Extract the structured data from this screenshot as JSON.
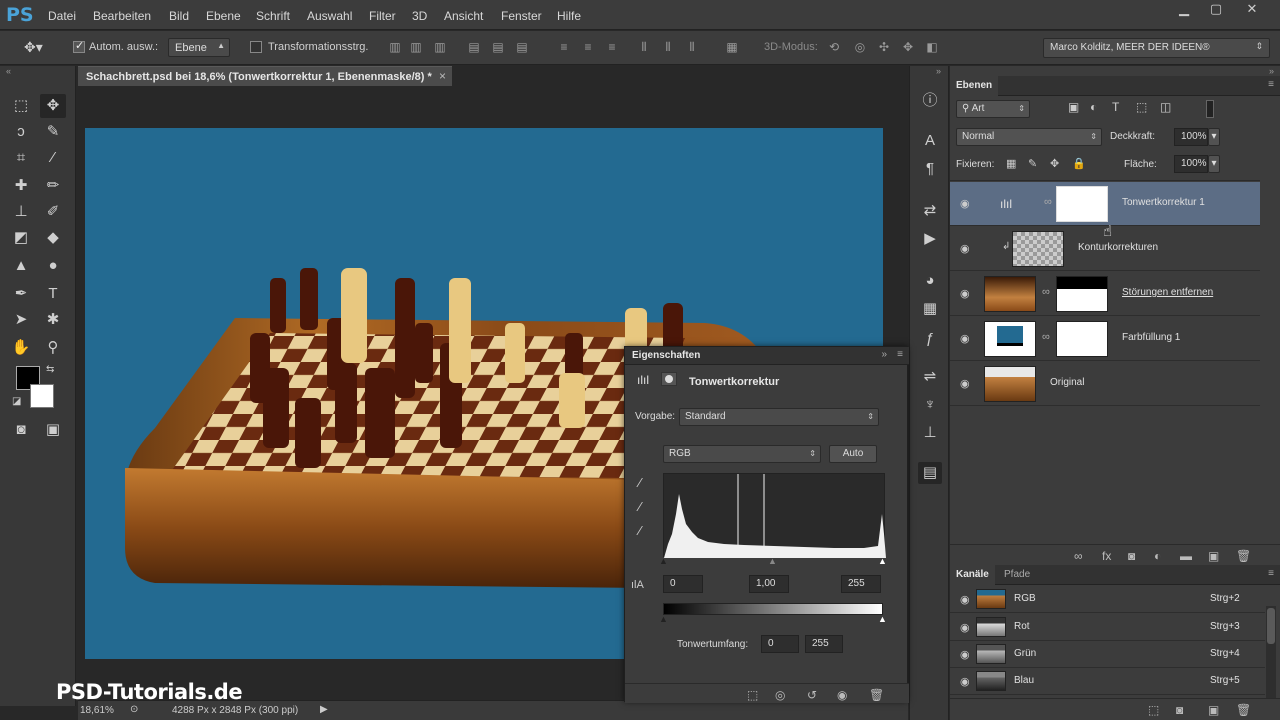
{
  "app": {
    "logo": "PS",
    "accent": "#4aa3d8"
  },
  "menu": [
    "Datei",
    "Bearbeiten",
    "Bild",
    "Ebene",
    "Schrift",
    "Auswahl",
    "Filter",
    "3D",
    "Ansicht",
    "Fenster",
    "Hilfe"
  ],
  "options_bar": {
    "auto_select_label": "Autom. ausw.:",
    "auto_select_value": "Ebene",
    "transform_label": "Transformationsstrg.",
    "mode_3d_label": "3D-Modus:",
    "workspace": "Marco Kolditz, MEER DER IDEEN®"
  },
  "document": {
    "tab_title": "Schachbrett.psd bei 18,6% (Tonwertkorrektur 1, Ebenenmaske/8) *",
    "close": "×",
    "canvas_color": "#236a91"
  },
  "watermark": "PSD-Tutorials.de",
  "status": {
    "zoom": "18,61%",
    "doc_size": "4288 Px x 2848 Px (300 ppi)"
  },
  "layers_panel": {
    "tab": "Ebenen",
    "filter_kind": "Art",
    "blend_mode": "Normal",
    "opacity_label": "Deckkraft:",
    "opacity": "100%",
    "lock_label": "Fixieren:",
    "fill_label": "Fläche:",
    "fill": "100%",
    "layers": [
      {
        "name": "Tonwertkorrektur 1",
        "selected": true
      },
      {
        "name": "Konturkorrekturen",
        "selected": false
      },
      {
        "name": "Störungen entfernen",
        "selected": false
      },
      {
        "name": "Farbfüllung 1",
        "selected": false
      },
      {
        "name": "Original",
        "selected": false
      }
    ]
  },
  "channels_panel": {
    "tabs": [
      "Kanäle",
      "Pfade"
    ],
    "channels": [
      {
        "name": "RGB",
        "shortcut": "Strg+2"
      },
      {
        "name": "Rot",
        "shortcut": "Strg+3"
      },
      {
        "name": "Grün",
        "shortcut": "Strg+4"
      },
      {
        "name": "Blau",
        "shortcut": "Strg+5"
      }
    ]
  },
  "properties": {
    "tab": "Eigenschaften",
    "title": "Tonwertkorrektur",
    "preset_label": "Vorgabe:",
    "preset": "Standard",
    "channel": "RGB",
    "auto_label": "Auto",
    "input_black": "0",
    "input_gamma": "1,00",
    "input_white": "255",
    "output_label": "Tonwertumfang:",
    "output_black": "0",
    "output_white": "255"
  }
}
